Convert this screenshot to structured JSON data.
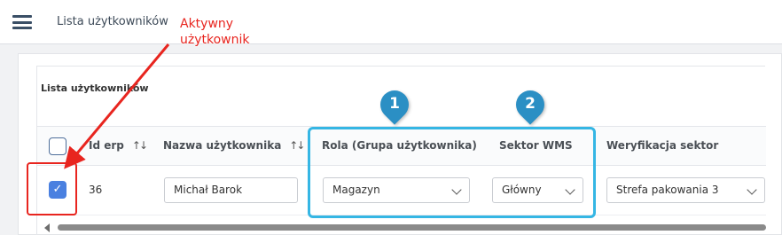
{
  "topbar": {
    "title": "Lista użytkowników"
  },
  "list": {
    "title": "Lista użytkowników"
  },
  "table": {
    "headers": {
      "id": "Id erp",
      "name": "Nazwa użytkownika",
      "role": "Rola (Grupa użytkownika)",
      "sector": "Sektor WMS",
      "verification": "Weryfikacja sektor"
    },
    "sort_glyph": "↑↓",
    "row": {
      "id": "36",
      "name": "Michał Barok",
      "role": "Magazyn",
      "sector": "Główny",
      "verification": "Strefa pakowania 3",
      "check_glyph": "✓"
    }
  },
  "annotations": {
    "active_user_line1": "Aktywny",
    "active_user_line2": "użytkownik",
    "pin1": "1",
    "pin2": "2"
  },
  "colors": {
    "annotation_red": "#e8251f",
    "annotation_blue": "#35b6e4",
    "pin_blue": "#2b8fc4",
    "checkbox_blue": "#4a80e0"
  }
}
